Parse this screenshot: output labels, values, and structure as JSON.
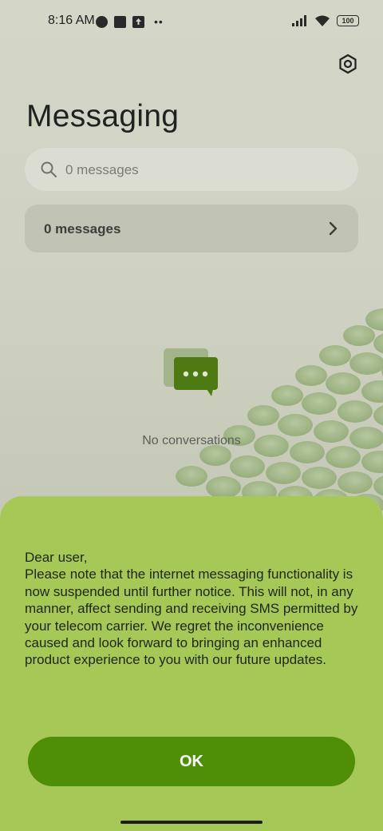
{
  "status_bar": {
    "time": "8:16 AM",
    "battery": "100",
    "icons": [
      "vpn-icon",
      "app-square-icon",
      "upload-icon",
      "more-dots-icon",
      "signal-icon",
      "wifi-icon",
      "battery-icon"
    ]
  },
  "header": {
    "title": "Messaging",
    "settings_icon": "gear-icon"
  },
  "search": {
    "placeholder": "0 messages",
    "icon": "search-icon"
  },
  "messages_row": {
    "label": "0 messages",
    "icon": "chevron-right-icon"
  },
  "empty_state": {
    "icon": "chat-bubble-icon",
    "text": "No conversations"
  },
  "notice": {
    "text": "Dear user,\nPlease note that the internet messaging functionality is now suspended until further notice. This will not, in any manner, affect sending and receiving SMS permitted by your telecom carrier. We regret the inconvenience caused and look forward to bringing an enhanced product experience to you with our future updates.",
    "button_label": "OK"
  },
  "colors": {
    "sheet_background": "#a5c857",
    "button_background": "#4e8f07",
    "button_text": "#ffffff",
    "screen_background": "#cfd1c2"
  }
}
